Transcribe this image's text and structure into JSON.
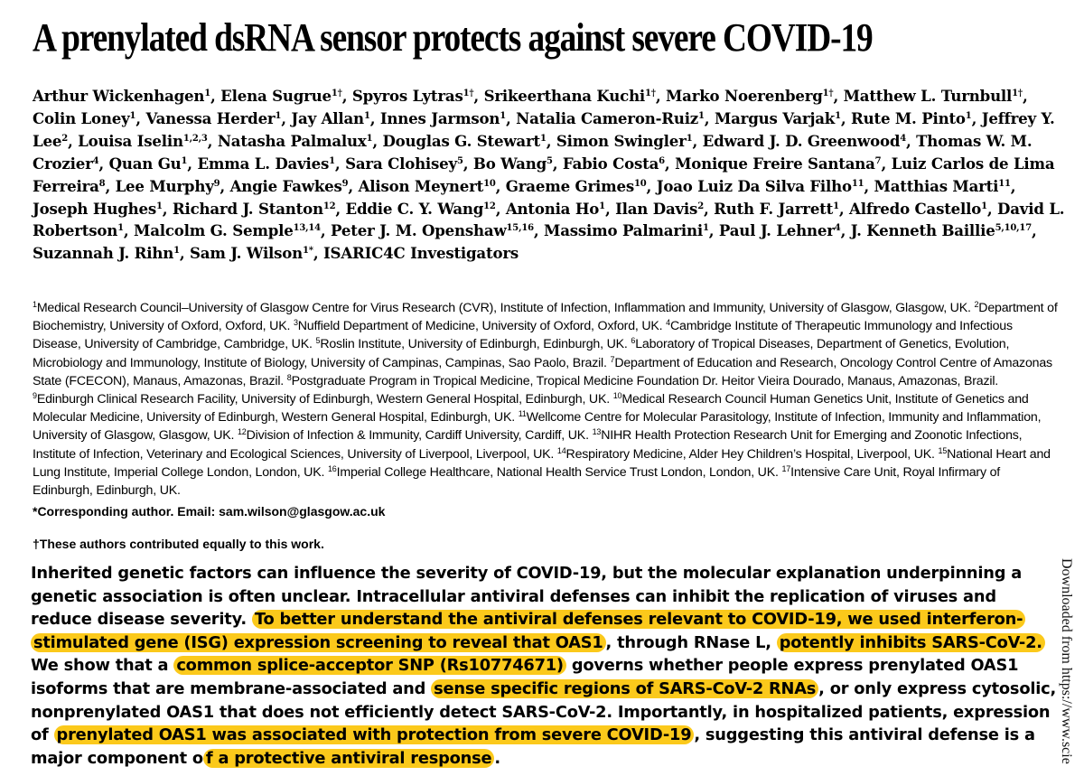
{
  "title": "A prenylated dsRNA sensor protects against severe COVID-19",
  "authors": [
    {
      "name": "Arthur Wickenhagen",
      "sup": "1"
    },
    {
      "name": "Elena Sugrue",
      "sup": "1†"
    },
    {
      "name": "Spyros Lytras",
      "sup": "1†"
    },
    {
      "name": "Srikeerthana Kuchi",
      "sup": "1†"
    },
    {
      "name": "Marko Noerenberg",
      "sup": "1†"
    },
    {
      "name": "Matthew L. Turnbull",
      "sup": "1†"
    },
    {
      "name": "Colin Loney",
      "sup": "1"
    },
    {
      "name": "Vanessa Herder",
      "sup": "1"
    },
    {
      "name": "Jay Allan",
      "sup": "1"
    },
    {
      "name": "Innes Jarmson",
      "sup": "1"
    },
    {
      "name": "Natalia Cameron-Ruiz",
      "sup": "1"
    },
    {
      "name": "Margus Varjak",
      "sup": "1"
    },
    {
      "name": "Rute M. Pinto",
      "sup": "1"
    },
    {
      "name": "Jeffrey Y. Lee",
      "sup": "2"
    },
    {
      "name": "Louisa Iselin",
      "sup": "1,2,3"
    },
    {
      "name": "Natasha Palmalux",
      "sup": "1"
    },
    {
      "name": "Douglas G. Stewart",
      "sup": "1"
    },
    {
      "name": "Simon Swingler",
      "sup": "1"
    },
    {
      "name": "Edward J. D. Greenwood",
      "sup": "4"
    },
    {
      "name": "Thomas W. M. Crozier",
      "sup": "4"
    },
    {
      "name": "Quan Gu",
      "sup": "1"
    },
    {
      "name": "Emma L. Davies",
      "sup": "1"
    },
    {
      "name": "Sara Clohisey",
      "sup": "5"
    },
    {
      "name": "Bo Wang",
      "sup": "5"
    },
    {
      "name": "Fabio Costa",
      "sup": "6"
    },
    {
      "name": "Monique Freire Santana",
      "sup": "7"
    },
    {
      "name": "Luiz Carlos de Lima Ferreira",
      "sup": "8"
    },
    {
      "name": "Lee Murphy",
      "sup": "9"
    },
    {
      "name": "Angie Fawkes",
      "sup": "9"
    },
    {
      "name": "Alison Meynert",
      "sup": "10"
    },
    {
      "name": "Graeme Grimes",
      "sup": "10"
    },
    {
      "name": "Joao Luiz Da Silva Filho",
      "sup": "11"
    },
    {
      "name": "Matthias Marti",
      "sup": "11"
    },
    {
      "name": "Joseph Hughes",
      "sup": "1"
    },
    {
      "name": "Richard J. Stanton",
      "sup": "12"
    },
    {
      "name": "Eddie C. Y. Wang",
      "sup": "12"
    },
    {
      "name": "Antonia Ho",
      "sup": "1"
    },
    {
      "name": "Ilan Davis",
      "sup": "2"
    },
    {
      "name": "Ruth F. Jarrett",
      "sup": "1"
    },
    {
      "name": "Alfredo Castello",
      "sup": "1"
    },
    {
      "name": "David L. Robertson",
      "sup": "1"
    },
    {
      "name": "Malcolm G. Semple",
      "sup": "13,14"
    },
    {
      "name": "Peter J. M. Openshaw",
      "sup": "15,16"
    },
    {
      "name": "Massimo Palmarini",
      "sup": "1"
    },
    {
      "name": "Paul J. Lehner",
      "sup": "4"
    },
    {
      "name": "J. Kenneth Baillie",
      "sup": "5,10,17"
    },
    {
      "name": "Suzannah J. Rihn",
      "sup": "1"
    },
    {
      "name": "Sam J. Wilson",
      "sup": "1*"
    },
    {
      "name": "ISARIC4C Investigators",
      "sup": ""
    }
  ],
  "affiliations": [
    {
      "num": "1",
      "text": "Medical Research Council–University of Glasgow Centre for Virus Research (CVR), Institute of Infection, Inflammation and Immunity, University of Glasgow, Glasgow, UK."
    },
    {
      "num": "2",
      "text": "Department of Biochemistry, University of Oxford, Oxford, UK."
    },
    {
      "num": "3",
      "text": "Nuffield Department of Medicine, University of Oxford, Oxford, UK."
    },
    {
      "num": "4",
      "text": "Cambridge Institute of Therapeutic Immunology and Infectious Disease, University of Cambridge, Cambridge, UK."
    },
    {
      "num": "5",
      "text": "Roslin Institute, University of Edinburgh, Edinburgh, UK."
    },
    {
      "num": "6",
      "text": "Laboratory of Tropical Diseases, Department of Genetics, Evolution, Microbiology and Immunology, Institute of Biology, University of Campinas, Campinas, Sao Paolo, Brazil."
    },
    {
      "num": "7",
      "text": "Department of Education and Research, Oncology Control Centre of Amazonas State (FCECON), Manaus, Amazonas, Brazil."
    },
    {
      "num": "8",
      "text": "Postgraduate Program in Tropical Medicine, Tropical Medicine Foundation Dr. Heitor Vieira Dourado, Manaus, Amazonas, Brazil."
    },
    {
      "num": "9",
      "text": "Edinburgh Clinical Research Facility, University of Edinburgh, Western General Hospital, Edinburgh, UK."
    },
    {
      "num": "10",
      "text": "Medical Research Council Human Genetics Unit, Institute of Genetics and Molecular Medicine, University of Edinburgh, Western General Hospital, Edinburgh, UK."
    },
    {
      "num": "11",
      "text": "Wellcome Centre for Molecular Parasitology, Institute of Infection, Immunity and Inflammation, University of Glasgow, Glasgow, UK."
    },
    {
      "num": "12",
      "text": "Division of Infection & Immunity, Cardiff University, Cardiff, UK."
    },
    {
      "num": "13",
      "text": "NIHR Health Protection Research Unit for Emerging and Zoonotic Infections, Institute of Infection, Veterinary and Ecological Sciences, University of Liverpool, Liverpool, UK."
    },
    {
      "num": "14",
      "text": "Respiratory Medicine, Alder Hey Children’s Hospital, Liverpool, UK."
    },
    {
      "num": "15",
      "text": "National Heart and Lung Institute, Imperial College London, London, UK."
    },
    {
      "num": "16",
      "text": "Imperial College Healthcare, National Health Service Trust London, London, UK."
    },
    {
      "num": "17",
      "text": "Intensive Care Unit, Royal Infirmary of Edinburgh, Edinburgh, UK."
    }
  ],
  "corresponding": "*Corresponding author. Email: sam.wilson@glasgow.ac.uk",
  "equal_contribution": "†These authors contributed equally to this work.",
  "abstract": {
    "segments": [
      {
        "text": "Inherited genetic factors can influence the severity of COVID-19, but the molecular explanation underpinning a genetic association is often unclear. Intracellular antiviral defenses can inhibit the replication of viruses and reduce disease severity. ",
        "highlight": false
      },
      {
        "text": "To better understand the antiviral defenses relevant to COVID-19, we used interferon-stimulated gene (ISG) expression screening to reveal that OAS1",
        "highlight": true
      },
      {
        "text": ", through RNase L, ",
        "highlight": false
      },
      {
        "text": "potently inhibits SARS-CoV-2.",
        "highlight": true
      },
      {
        "text": " We show that a ",
        "highlight": false
      },
      {
        "text": "common splice-acceptor SNP (Rs10774671)",
        "highlight": true
      },
      {
        "text": " governs whether people express prenylated OAS1 isoforms that are membrane-associated and ",
        "highlight": false
      },
      {
        "text": "sense specific regions of SARS-CoV-2 RNAs",
        "highlight": true
      },
      {
        "text": ", or only express cytosolic, nonprenylated OAS1 that does not efficiently detect SARS-CoV-2. Importantly, in hospitalized patients, expression of ",
        "highlight": false
      },
      {
        "text": "prenylated OAS1 was associated with protection from severe COVID-19",
        "highlight": true
      },
      {
        "text": ", suggesting this antiviral defense is a major component o",
        "highlight": false
      },
      {
        "text": "f a protective antiviral response",
        "highlight": true
      },
      {
        "text": ".",
        "highlight": false
      }
    ]
  },
  "sidebar_text": "Downloaded from https://www.scie",
  "colors": {
    "highlight": "#fbc91b",
    "text": "#000000",
    "background": "#ffffff"
  }
}
